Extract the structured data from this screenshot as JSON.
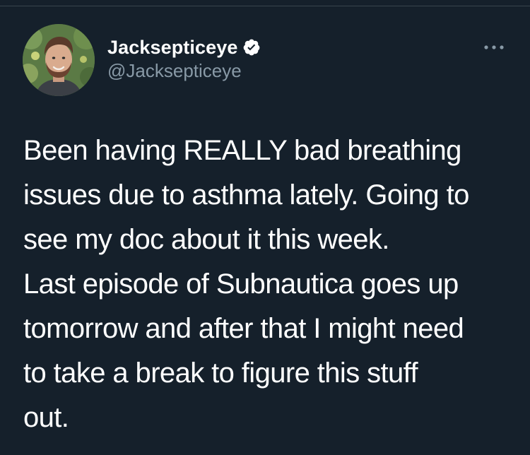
{
  "tweet": {
    "author": {
      "display_name": "Jacksepticeye",
      "handle": "@Jacksepticeye",
      "verified": true,
      "avatar_icon": "profile-photo"
    },
    "more_icon": "ellipsis-icon",
    "text_lines": [
      "Been having REALLY bad breathing",
      "issues due to asthma lately. Going to",
      "see my doc about it this week.",
      "Last episode of Subnautica goes up",
      "tomorrow and after that I might need",
      "to take a break to figure this stuff",
      "out."
    ]
  },
  "colors": {
    "background": "#15202b",
    "text_primary": "#ffffff",
    "text_secondary": "#8899a6",
    "divider": "#38444d"
  }
}
